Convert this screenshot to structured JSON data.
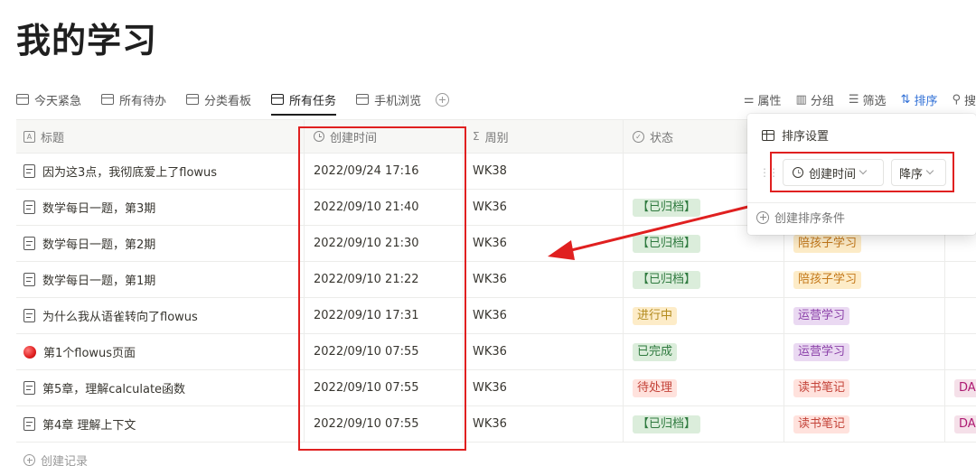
{
  "page_title": "我的学习",
  "tabs": [
    {
      "label": "今天紧急",
      "icon": "table-icon"
    },
    {
      "label": "所有待办",
      "icon": "table-icon"
    },
    {
      "label": "分类看板",
      "icon": "board-icon"
    },
    {
      "label": "所有任务",
      "icon": "table-icon",
      "active": true
    },
    {
      "label": "手机浏览",
      "icon": "list-icon"
    }
  ],
  "toolbar": {
    "properties": "属性",
    "group": "分组",
    "filter": "筛选",
    "sort": "排序",
    "search": "搜"
  },
  "table": {
    "columns": [
      {
        "label": "标题",
        "icon": "text-type-icon"
      },
      {
        "label": "创建时间",
        "icon": "clock-icon"
      },
      {
        "label": "周别",
        "icon": "sigma-icon"
      },
      {
        "label": "状态",
        "icon": "check-circle-icon"
      }
    ],
    "rows": [
      {
        "title": "因为这3点，我彻底爱上了flowus",
        "created": "2022/09/24 17:16",
        "week": "WK38",
        "status": "",
        "category": "",
        "extra": ""
      },
      {
        "title": "数学每日一题，第3期",
        "created": "2022/09/10 21:40",
        "week": "WK36",
        "status": "【已归档】",
        "category": "",
        "extra": ""
      },
      {
        "title": "数学每日一题，第2期",
        "created": "2022/09/10 21:30",
        "week": "WK36",
        "status": "【已归档】",
        "category": "陪孩子学习",
        "extra": ""
      },
      {
        "title": "数学每日一题，第1期",
        "created": "2022/09/10 21:22",
        "week": "WK36",
        "status": "【已归档】",
        "category": "陪孩子学习",
        "extra": ""
      },
      {
        "title": "为什么我从语雀转向了flowus",
        "created": "2022/09/10 17:31",
        "week": "WK36",
        "status": "进行中",
        "category": "运营学习",
        "extra": ""
      },
      {
        "title": "第1个flowus页面",
        "created": "2022/09/10 07:55",
        "week": "WK36",
        "status": "已完成",
        "category": "运营学习",
        "extra": ""
      },
      {
        "title": "第5章，理解calculate函数",
        "created": "2022/09/10 07:55",
        "week": "WK36",
        "status": "待处理",
        "category": "读书笔记",
        "extra": "DA"
      },
      {
        "title": "第4章 理解上下文",
        "created": "2022/09/10 07:55",
        "week": "WK36",
        "status": "【已归档】",
        "category": "读书笔记",
        "extra": "DA"
      }
    ],
    "add_record": "创建记录"
  },
  "sort_panel": {
    "title": "排序设置",
    "field": "创建时间",
    "direction": "降序",
    "add_condition": "创建排序条件"
  },
  "colors": {
    "highlight_red": "#e02020",
    "sort_active_blue": "#2f6fd6"
  }
}
